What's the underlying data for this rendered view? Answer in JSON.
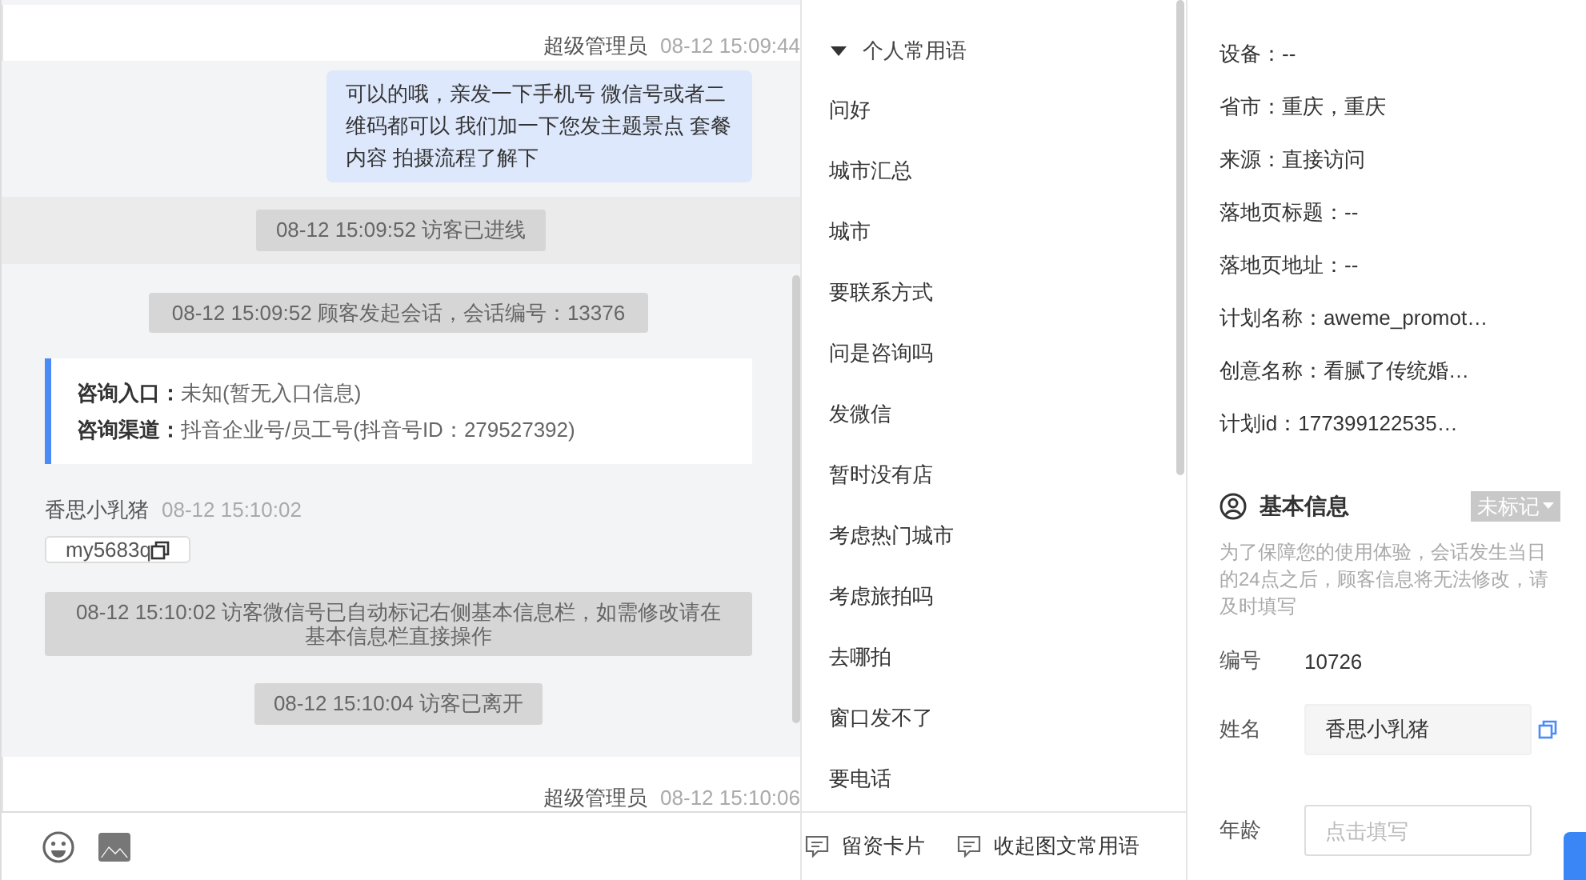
{
  "chat": {
    "messages": [
      {
        "kind": "agent",
        "sender": "超级管理员",
        "time": "08-12 15:09:44",
        "text": "可以的哦，亲发一下手机号 微信号或者二维码都可以 我们加一下您发主题景点 套餐内容 拍摄流程了解下"
      },
      {
        "kind": "notice",
        "text": "08-12 15:09:52 访客已进线",
        "highlighted": true
      },
      {
        "kind": "notice",
        "text": "08-12 15:09:52 顾客发起会话，会话编号：13376",
        "highlighted": false
      },
      {
        "kind": "card",
        "rows": [
          {
            "label": "咨询入口：",
            "value": "未知(暂无入口信息)"
          },
          {
            "label": "咨询渠道：",
            "value": "抖音企业号/员工号(抖音号ID：279527392)"
          }
        ]
      },
      {
        "kind": "visitor",
        "sender": "香思小乳猪",
        "time": "08-12 15:10:02",
        "text": "my5683q"
      },
      {
        "kind": "notice",
        "text": "08-12 15:10:02 访客微信号已自动标记右侧基本信息栏，如需修改请在基本信息栏直接操作",
        "highlighted": false
      },
      {
        "kind": "notice",
        "text": "08-12 15:10:04 访客已离开",
        "highlighted": false
      },
      {
        "kind": "agent",
        "sender": "超级管理员",
        "time": "08-12 15:10:06"
      }
    ]
  },
  "phrases": {
    "group": {
      "label": "个人常用语",
      "expanded": true
    },
    "items": [
      "问好",
      "城市汇总",
      "城市",
      "要联系方式",
      "问是咨询吗",
      "发微信",
      "暂时没有店",
      "考虑热门城市",
      "考虑旅拍吗",
      "去哪拍",
      "窗口发不了",
      "要电话"
    ],
    "footer": [
      "留资卡片",
      "收起图文常用语"
    ]
  },
  "visitor_info": {
    "fields": [
      "设备：--",
      "省市：重庆，重庆",
      "来源：直接访问",
      "落地页标题：--",
      "落地页地址：--",
      "计划名称：aweme_promot…",
      "创意名称：看腻了传统婚…",
      "计划id：177399122535…"
    ]
  },
  "basic_info": {
    "title": "基本信息",
    "tag": "未标记",
    "note": "为了保障您的使用体验，会话发生当日的24点之后，顾客信息将无法修改，请及时填写",
    "rows": [
      {
        "kind": "text",
        "label": "编号",
        "value": "10726"
      },
      {
        "kind": "input",
        "label": "姓名",
        "value": "香思小乳猪"
      },
      {
        "kind": "input",
        "label": "年龄",
        "placeholder": "点击填写"
      }
    ]
  }
}
